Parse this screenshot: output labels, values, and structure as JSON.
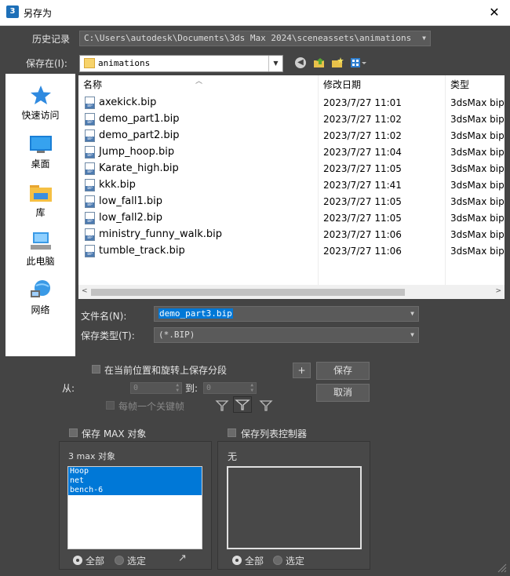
{
  "window": {
    "title": "另存为",
    "app_icon_text": "3",
    "close_glyph": "✕"
  },
  "history": {
    "label": "历史记录",
    "value": "C:\\Users\\autodesk\\Documents\\3ds Max 2024\\sceneassets\\animations"
  },
  "save_in": {
    "label": "保存在(I):",
    "value": "animations"
  },
  "sidebar": [
    {
      "label": "快速访问",
      "icon": "star-icon"
    },
    {
      "label": "桌面",
      "icon": "desktop-icon"
    },
    {
      "label": "库",
      "icon": "library-icon"
    },
    {
      "label": "此电脑",
      "icon": "computer-icon"
    },
    {
      "label": "网络",
      "icon": "network-icon"
    }
  ],
  "file_list": {
    "columns": [
      "名称",
      "修改日期",
      "类型"
    ],
    "rows": [
      {
        "name": "axekick.bip",
        "date": "2023/7/27 11:01",
        "type": "3dsMax bip"
      },
      {
        "name": "demo_part1.bip",
        "date": "2023/7/27 11:02",
        "type": "3dsMax bip"
      },
      {
        "name": "demo_part2.bip",
        "date": "2023/7/27 11:02",
        "type": "3dsMax bip"
      },
      {
        "name": "Jump_hoop.bip",
        "date": "2023/7/27 11:04",
        "type": "3dsMax bip"
      },
      {
        "name": "Karate_high.bip",
        "date": "2023/7/27 11:05",
        "type": "3dsMax bip"
      },
      {
        "name": "kkk.bip",
        "date": "2023/7/27 11:41",
        "type": "3dsMax bip"
      },
      {
        "name": "low_fall1.bip",
        "date": "2023/7/27 11:05",
        "type": "3dsMax bip"
      },
      {
        "name": "low_fall2.bip",
        "date": "2023/7/27 11:05",
        "type": "3dsMax bip"
      },
      {
        "name": "ministry_funny_walk.bip",
        "date": "2023/7/27 11:06",
        "type": "3dsMax bip"
      },
      {
        "name": "tumble_track.bip",
        "date": "2023/7/27 11:06",
        "type": "3dsMax bip"
      }
    ]
  },
  "filename": {
    "label": "文件名(N):",
    "value": "demo_part3.bip"
  },
  "filetype": {
    "label": "保存类型(T):",
    "value": "(*.BIP)"
  },
  "save_segment": {
    "label": "在当前位置和旋转上保存分段"
  },
  "plus_button": "+",
  "save_button": "保存",
  "cancel_button": "取消",
  "range": {
    "from_label": "从:",
    "from_value": "0",
    "to_label": "到:",
    "to_value": "0"
  },
  "per_frame_key": "每帧一个关键帧",
  "max_objects": {
    "checkbox_label": "保存 MAX 对象",
    "count_label": "3 max 对象",
    "items": [
      "Hoop",
      "net",
      "bench-6"
    ],
    "radio_all": "全部",
    "radio_selected": "选定"
  },
  "list_controllers": {
    "checkbox_label": "保存列表控制器",
    "none_label": "无",
    "radio_all": "全部",
    "radio_selected": "选定"
  }
}
